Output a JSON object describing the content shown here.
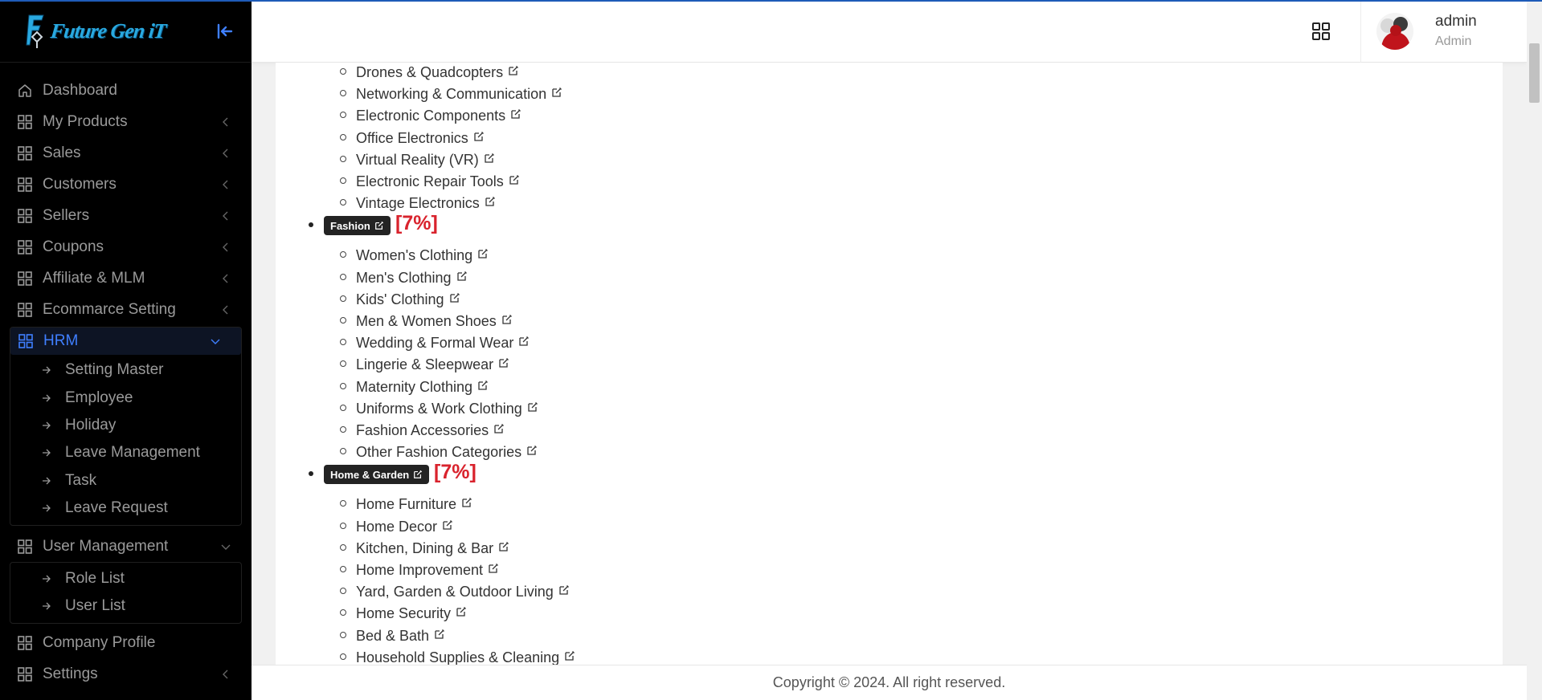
{
  "brand": {
    "logo_text": "Future Gen iT"
  },
  "sidebar": {
    "items": [
      {
        "label": "Dashboard",
        "icon": "home-icon",
        "chevron": "none"
      },
      {
        "label": "My Products",
        "icon": "grid-icon",
        "chevron": "left"
      },
      {
        "label": "Sales",
        "icon": "grid-icon",
        "chevron": "left"
      },
      {
        "label": "Customers",
        "icon": "grid-icon",
        "chevron": "left"
      },
      {
        "label": "Sellers",
        "icon": "grid-icon",
        "chevron": "left"
      },
      {
        "label": "Coupons",
        "icon": "grid-icon",
        "chevron": "left"
      },
      {
        "label": "Affiliate & MLM",
        "icon": "grid-icon",
        "chevron": "left"
      },
      {
        "label": "Ecommarce Setting",
        "icon": "grid-icon",
        "chevron": "left"
      }
    ],
    "hrm": {
      "label": "HRM",
      "sub_items": [
        "Setting Master",
        "Employee",
        "Holiday",
        "Leave Management",
        "Task",
        "Leave Request"
      ]
    },
    "user_management": {
      "label": "User Management",
      "sub_items": [
        "Role List",
        "User List"
      ]
    },
    "bottom_items": [
      {
        "label": "Company Profile"
      },
      {
        "label": "Settings"
      }
    ]
  },
  "header": {
    "user_name": "admin",
    "user_role": "Admin"
  },
  "tree": {
    "electronics_children": [
      "Drones & Quadcopters",
      "Networking & Communication",
      "Electronic Components",
      "Office Electronics",
      "Virtual Reality (VR)",
      "Electronic Repair Tools",
      "Vintage Electronics"
    ],
    "categories": [
      {
        "name": "Fashion",
        "percent": "[7%]",
        "children": [
          "Women's Clothing",
          "Men's Clothing",
          "Kids' Clothing",
          "Men & Women Shoes",
          "Wedding & Formal Wear",
          "Lingerie & Sleepwear",
          "Maternity Clothing",
          "Uniforms & Work Clothing",
          "Fashion Accessories",
          "Other Fashion Categories"
        ]
      },
      {
        "name": "Home & Garden",
        "percent": "[7%]",
        "children": [
          "Home Furniture",
          "Home Decor",
          "Kitchen, Dining & Bar",
          "Home Improvement",
          "Yard, Garden & Outdoor Living",
          "Home Security",
          "Bed & Bath",
          "Household Supplies & Cleaning"
        ]
      }
    ]
  },
  "footer": {
    "copyright": "Copyright © 2024. All right reserved."
  },
  "colors": {
    "sidebar_bg": "#000000",
    "sidebar_text": "#9a9a9a",
    "active": "#3f7fff",
    "badge_bg": "#232323",
    "percent_red": "#d9232d"
  }
}
